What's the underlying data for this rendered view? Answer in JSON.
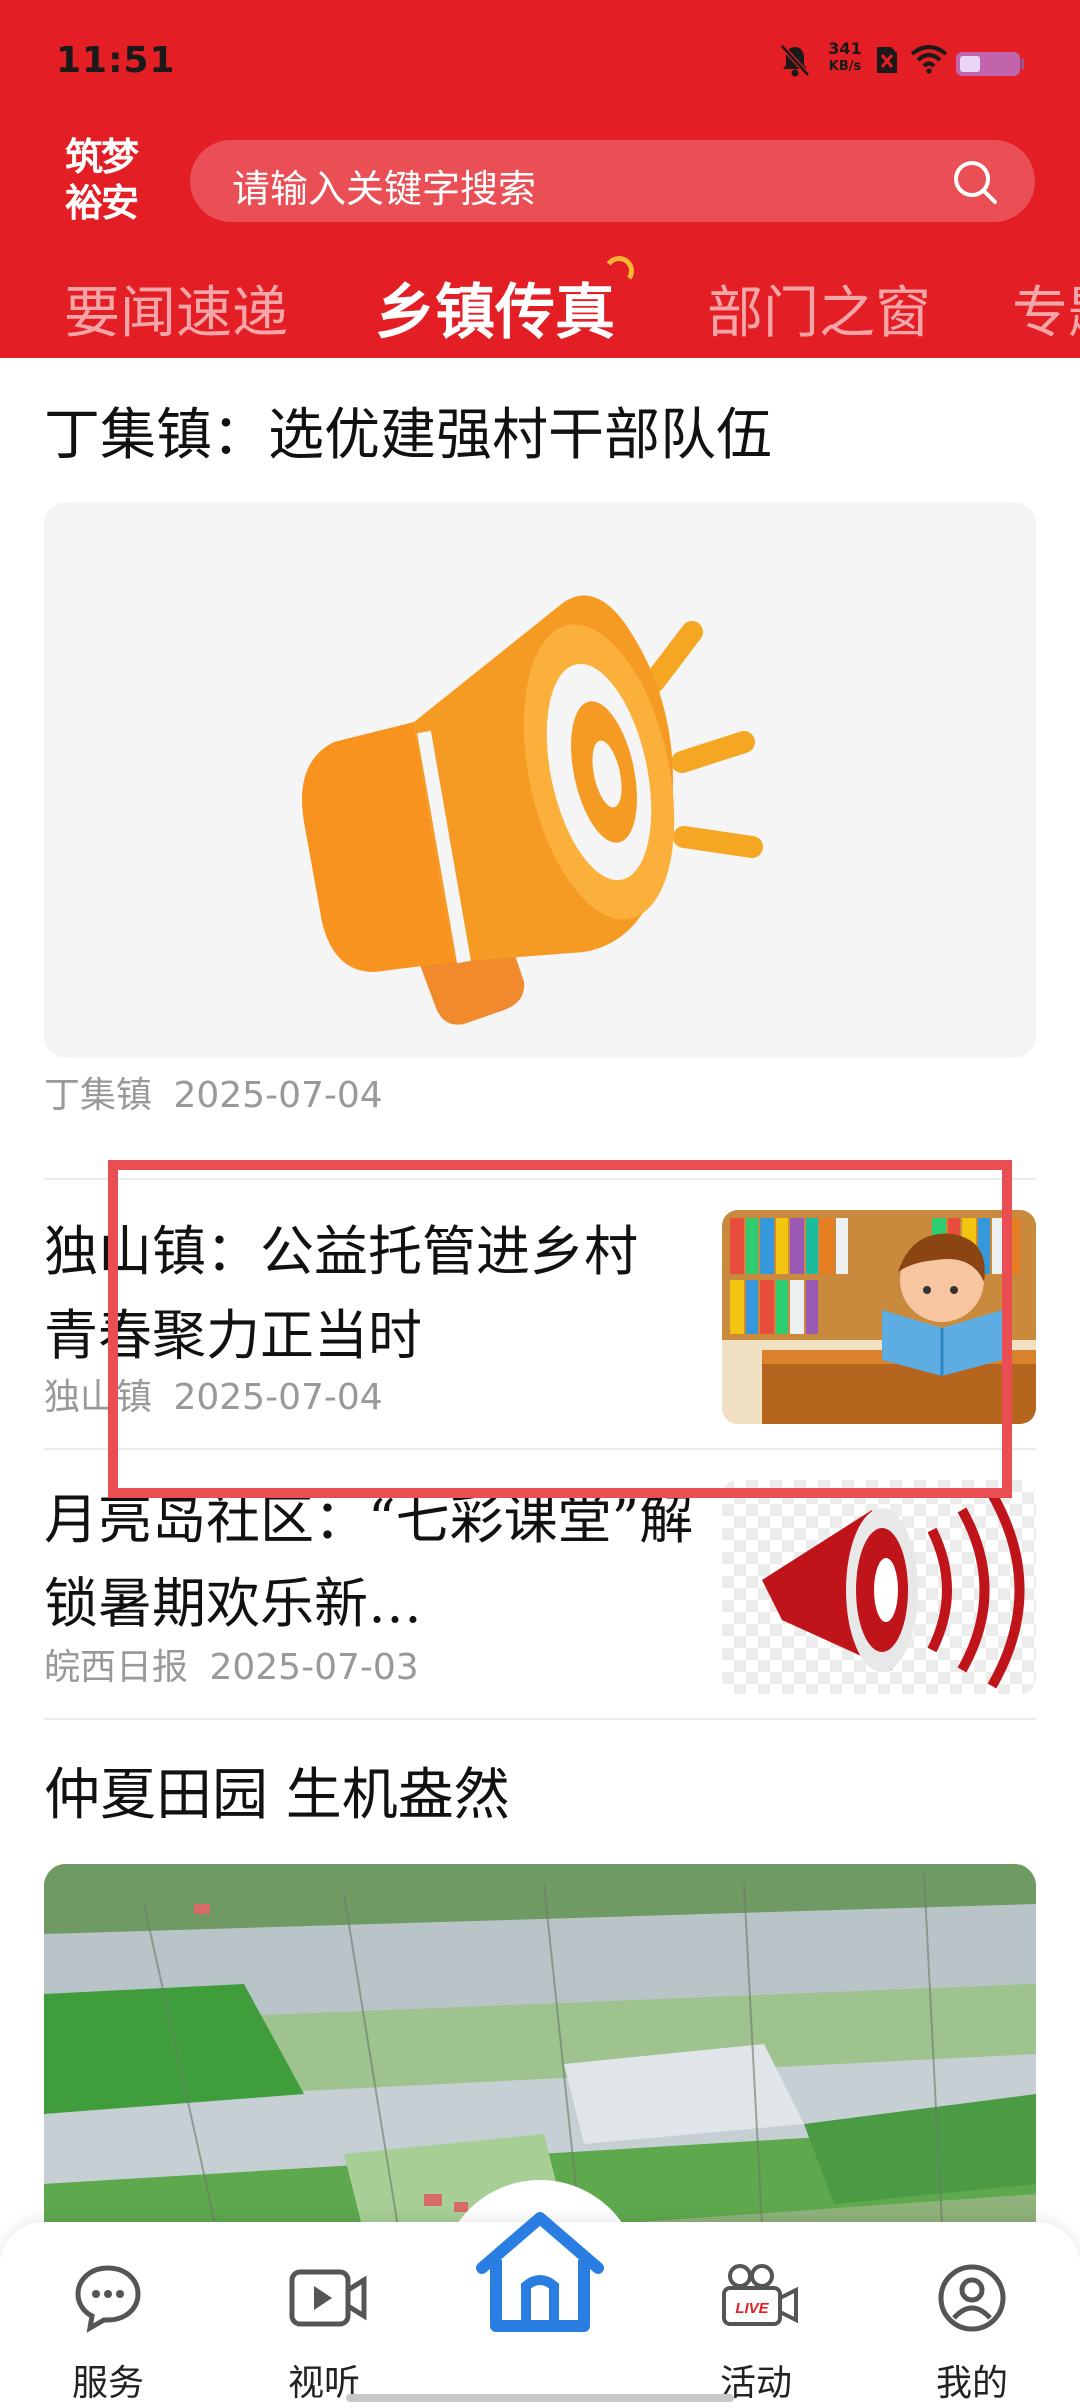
{
  "status_bar": {
    "time": "11:51",
    "net_speed_value": "341",
    "net_speed_unit": "KB/s",
    "icons": [
      "bell-off-icon",
      "nosim-icon",
      "wifi-icon",
      "battery-icon"
    ]
  },
  "header": {
    "logo_line1": "筑梦",
    "logo_line2": "裕安",
    "search_placeholder": "请输入关键字搜索",
    "brand_color": "#e31e24"
  },
  "tabs": [
    {
      "label": "要闻速递",
      "active": false
    },
    {
      "label": "乡镇传真",
      "active": true
    },
    {
      "label": "部门之窗",
      "active": false
    },
    {
      "label": "专题",
      "active": false
    }
  ],
  "feed": [
    {
      "title": "丁集镇：选优建强村干部队伍",
      "source": "丁集镇",
      "date": "2025-07-04",
      "image": "megaphone-icon"
    },
    {
      "title": "独山镇：公益托管进乡村 青春聚力正当时",
      "source": "独山镇",
      "date": "2025-07-04",
      "image": "child-reading-illustration"
    },
    {
      "title": "月亮岛社区：“七彩课堂”解锁暑期欢乐新…",
      "source": "皖西日报",
      "date": "2025-07-03",
      "image": "red-megaphone-illustration"
    },
    {
      "title": "仲夏田园 生机盎然",
      "image": "farmland-aerial-photo"
    }
  ],
  "bottom_nav": [
    {
      "label": "服务",
      "icon": "chat-bubble-icon"
    },
    {
      "label": "视听",
      "icon": "video-play-icon"
    },
    {
      "label": "",
      "icon": "home-icon"
    },
    {
      "label": "活动",
      "icon": "live-camera-icon"
    },
    {
      "label": "我的",
      "icon": "user-icon"
    }
  ],
  "highlight_color": "#ea4e53"
}
